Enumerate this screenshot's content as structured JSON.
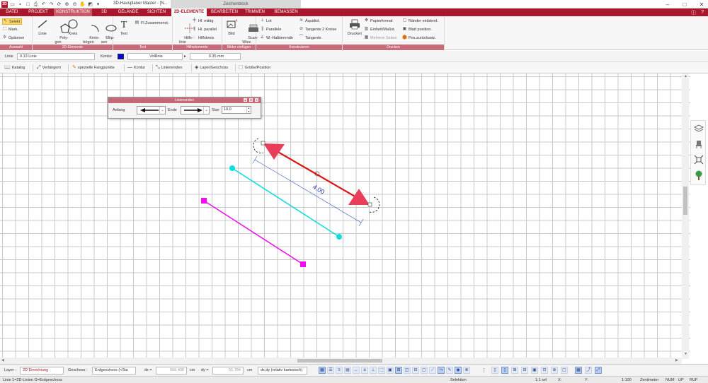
{
  "window": {
    "title": "3D-Hausplaner Master - [N...",
    "context_title": "Zeichenblock",
    "logo": "3D"
  },
  "menu_tabs": [
    "DATEI",
    "PROJEKT",
    "KONSTRUKTION",
    "3D",
    "GELÄNDE",
    "SICHTEN",
    "2D-ELEMENTE",
    "BEARBEITEN",
    "TRIMMEN",
    "BEMASSEN"
  ],
  "ribbon": {
    "auswahl": {
      "label": "Auswahl",
      "selekt": "Selekt",
      "mark": "Mark.",
      "optionen": "Optionen"
    },
    "elemente2d": {
      "label": "2D-Elemente",
      "linie": "Linie",
      "polygon": "Poly-\ngon",
      "kreis": "Kreis",
      "kreisboegen": "Kreis-\nbögen",
      "ellipsen": "Ellip-\nsen"
    },
    "text": {
      "label": "Text",
      "text": "Text",
      "fl_zusammenst": "Fl.Zusammenst."
    },
    "hilfselemente": {
      "label": "Hilfselemente",
      "hilfslinie": "Hilfs-\nlinie",
      "hl_mittig": "Hl. mittig",
      "hl_parallel": "Hl. parallel",
      "hilfskreis": "Hilfskreis"
    },
    "bilder": {
      "label": "Bilder einfügen",
      "bild": "Bild",
      "scan": "Scan-\nWizz."
    },
    "konstruieren": {
      "label": "Konstruieren",
      "lot": "Lot",
      "parallele": "Parallele",
      "w_halbierende": "W.-Halbierende",
      "aequidist": "Äquidist.",
      "tangente2": "Tangente 2 Kreise",
      "tangente": "Tangente"
    },
    "drucken": {
      "label": "Drucken",
      "drucken": "Drucken",
      "papierformat": "Papierformat",
      "einheit": "Einheit/Maßst.",
      "mehrere_seiten": "Mehrere Seiten",
      "raender": "Ränder einblend.",
      "blatt": "Blatt position.",
      "pos": "Pos.zurücksetz."
    }
  },
  "propbar": {
    "linie_label": "Linie",
    "linie_value": "0.13 Linie",
    "kontur_label": "Kontur",
    "kontur_color": "#0000ee",
    "linetype": "Volllinie",
    "width": "0.35 mm"
  },
  "toolbar2": [
    "Katalog",
    "Verlängern",
    "spezielle Fangpunkte",
    "Kontur",
    "Linienenden",
    "Layer/Geschoss",
    "Größe/Position"
  ],
  "dialog": {
    "title": "Linienenden",
    "anfang_label": "Anfang",
    "ende_label": "Ende",
    "size_label": "Size",
    "size_value": "10.0"
  },
  "canvas": {
    "dimension_label": "4.00",
    "colors": {
      "red_arrow": "#dd1111",
      "arrow_head": "#e83e5a",
      "cyan_line": "#11dddd",
      "magenta_line": "#ee11ee",
      "dimension": "#3355cc"
    }
  },
  "bottombar": {
    "layer_label": "Layer :",
    "layer_value": "2D Einrichtung",
    "geschoss_label": "Geschoss :",
    "geschoss_value": "Erdgeschoss (<Sta",
    "dx_label": "dx =",
    "dx_value": "556,408",
    "dx_unit": "cm",
    "dy_label": "dy =",
    "dy_value": "51,784",
    "dy_unit": "cm",
    "mode": "dx,dy (relativ kartesisch)"
  },
  "statusbar": {
    "info": "Linie 1=2D-Linien G=Erdgeschoss",
    "selektion": "Selektion",
    "sel": "1:1 sel",
    "x": "X:",
    "y": "Y:",
    "scale": "1:100",
    "unit": "Zentimeter",
    "num": "NUM",
    "up": "UP",
    "ruf": "RUF"
  }
}
